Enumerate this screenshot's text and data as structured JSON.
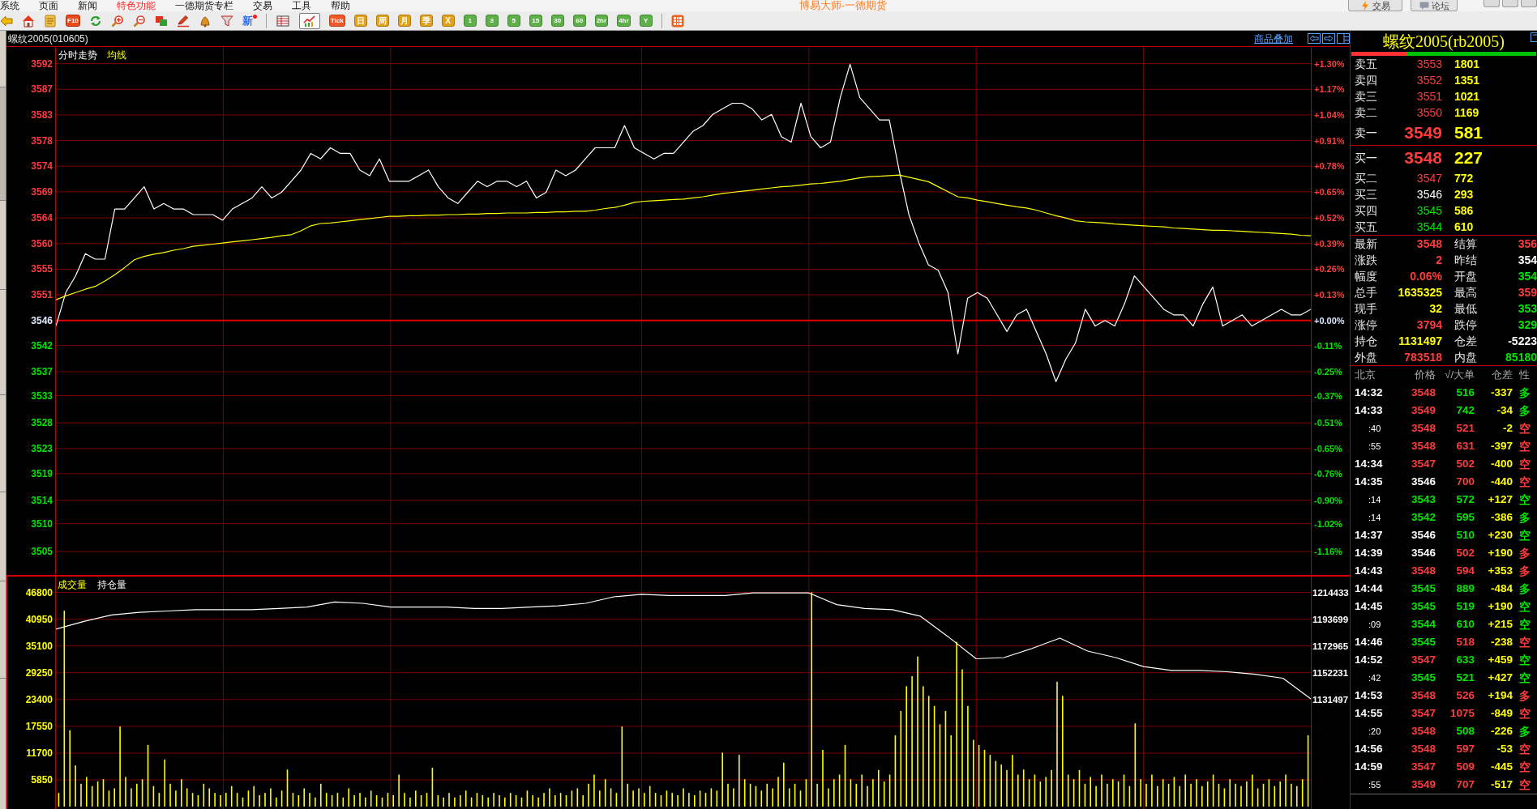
{
  "menu": [
    {
      "label": "系统",
      "highlight": false
    },
    {
      "label": "页面",
      "highlight": false
    },
    {
      "label": "新闻",
      "highlight": false
    },
    {
      "label": "特色功能",
      "highlight": true
    },
    {
      "label": "一德期货专栏",
      "highlight": false
    },
    {
      "label": "交易",
      "highlight": false
    },
    {
      "label": "工具",
      "highlight": false
    },
    {
      "label": "帮助",
      "highlight": false
    }
  ],
  "window": {
    "title": "博易大师-一德期货"
  },
  "top_buttons": [
    {
      "kind": "trade",
      "label": "交易"
    },
    {
      "kind": "forum",
      "label": "论坛"
    }
  ],
  "toolbar": {
    "f10_label": "F10",
    "new_label": "新",
    "views": [
      {
        "selected": false
      },
      {
        "selected": true
      }
    ],
    "periods": [
      {
        "kind": "tick",
        "label": "Tick",
        "selected": false
      },
      {
        "kind": "calendar",
        "label": "日",
        "selected": false
      },
      {
        "kind": "calendar",
        "label": "周",
        "selected": false
      },
      {
        "kind": "calendar",
        "label": "月",
        "selected": false
      },
      {
        "kind": "calendar",
        "label": "季",
        "selected": false
      },
      {
        "kind": "calendar",
        "label": "X",
        "selected": false
      },
      {
        "kind": "interval",
        "label": "1",
        "selected": false
      },
      {
        "kind": "interval",
        "label": "3",
        "selected": false
      },
      {
        "kind": "interval",
        "label": "5",
        "selected": false
      },
      {
        "kind": "interval",
        "label": "15",
        "selected": false
      },
      {
        "kind": "interval",
        "label": "30",
        "selected": false
      },
      {
        "kind": "interval",
        "label": "60",
        "selected": false
      },
      {
        "kind": "interval",
        "label": "2hr",
        "selected": false
      },
      {
        "kind": "interval",
        "label": "4hr",
        "selected": false
      },
      {
        "kind": "interval",
        "label": "Y",
        "selected": false
      }
    ]
  },
  "chart_header": {
    "symbol": "螺纹2005(010605)",
    "overlay_link": "商品叠加"
  },
  "price_chart": {
    "percent_labels": [
      "+1.30%",
      "+1.17%",
      "+1.04%",
      "+0.91%",
      "+0.78%",
      "+0.65%",
      "+0.52%",
      "+0.39%",
      "+0.26%",
      "+0.13%",
      "+0.00%",
      "-0.11%",
      "-0.25%",
      "-0.37%",
      "-0.51%",
      "-0.65%",
      "-0.76%",
      "-0.90%",
      "-1.02%",
      "-1.16%"
    ],
    "chart_data": {
      "type": "line",
      "ylim": [
        3500.3,
        3595.1
      ],
      "yticks": [
        {
          "value": 3592.1,
          "label": "3592"
        },
        {
          "value": 3587.5,
          "label": "3587"
        },
        {
          "value": 3582.9,
          "label": "3583"
        },
        {
          "value": 3578.3,
          "label": "3578"
        },
        {
          "value": 3573.7,
          "label": "3574"
        },
        {
          "value": 3569.1,
          "label": "3569"
        },
        {
          "value": 3564.4,
          "label": "3564"
        },
        {
          "value": 3559.8,
          "label": "3560"
        },
        {
          "value": 3555.2,
          "label": "3555"
        },
        {
          "value": 3550.6,
          "label": "3551"
        },
        {
          "value": 3546,
          "label": "3546"
        },
        {
          "value": 3541.5,
          "label": "3542"
        },
        {
          "value": 3536.8,
          "label": "3537"
        },
        {
          "value": 3532.5,
          "label": "3533"
        },
        {
          "value": 3527.6,
          "label": "3528"
        },
        {
          "value": 3523.0,
          "label": "3523"
        },
        {
          "value": 3518.5,
          "label": "3519"
        },
        {
          "value": 3513.7,
          "label": "3514"
        },
        {
          "value": 3509.5,
          "label": "3510"
        },
        {
          "value": 3504.5,
          "label": "3505"
        }
      ],
      "grid": true,
      "series": [
        {
          "name": "分时走势",
          "color": "#ffffff",
          "values": [
            3545,
            3551,
            3554,
            3558,
            3557,
            3557,
            3566,
            3566,
            3568,
            3570,
            3566,
            3567,
            3566,
            3566,
            3565,
            3565,
            3565,
            3564,
            3566,
            3567,
            3568,
            3570,
            3568,
            3569,
            3571,
            3573,
            3576,
            3575,
            3577,
            3576,
            3576,
            3573,
            3572,
            3575,
            3571,
            3571,
            3571,
            3572,
            3573,
            3570,
            3568,
            3567,
            3569,
            3571,
            3570,
            3571,
            3571,
            3570,
            3571,
            3568,
            3569,
            3573,
            3572,
            3573,
            3575,
            3577,
            3577,
            3577,
            3581,
            3577,
            3576,
            3575,
            3576,
            3576,
            3578,
            3580,
            3581,
            3583,
            3584,
            3585,
            3585,
            3584,
            3582,
            3583,
            3579,
            3578,
            3585,
            3579,
            3577,
            3578,
            3586,
            3592,
            3586,
            3584,
            3582,
            3582,
            3573,
            3565,
            3560,
            3556,
            3555,
            3551,
            3540,
            3550,
            3551,
            3550,
            3547,
            3544,
            3547,
            3548,
            3544,
            3540,
            3535,
            3539,
            3542,
            3548,
            3545,
            3546,
            3545,
            3549,
            3554,
            3552,
            3550,
            3548,
            3547,
            3547,
            3545,
            3549,
            3552,
            3545,
            3546,
            3547,
            3545,
            3546,
            3547,
            3548,
            3547,
            3547,
            3548
          ]
        },
        {
          "name": "均线",
          "color": "#ffff00",
          "values": [
            3549.7,
            3550.4,
            3551.0,
            3551.6,
            3552.1,
            3553.1,
            3554.2,
            3555.5,
            3556.9,
            3557.5,
            3557.9,
            3558.2,
            3558.6,
            3558.9,
            3559.3,
            3559.5,
            3559.7,
            3559.9,
            3560.1,
            3560.3,
            3560.5,
            3560.7,
            3560.9,
            3561.2,
            3561.4,
            3562.1,
            3563.0,
            3563.4,
            3563.5,
            3563.7,
            3563.9,
            3564.1,
            3564.3,
            3564.5,
            3564.7,
            3564.7,
            3564.8,
            3564.8,
            3564.9,
            3564.9,
            3565.0,
            3565.0,
            3565.1,
            3565.1,
            3565.2,
            3565.2,
            3565.3,
            3565.3,
            3565.3,
            3565.4,
            3565.4,
            3565.5,
            3565.5,
            3565.6,
            3565.6,
            3565.8,
            3566.1,
            3566.3,
            3566.7,
            3567.2,
            3567.4,
            3567.5,
            3567.6,
            3567.7,
            3567.8,
            3568.0,
            3568.2,
            3568.5,
            3568.8,
            3569.0,
            3569.2,
            3569.4,
            3569.6,
            3569.8,
            3570.0,
            3570.1,
            3570.3,
            3570.5,
            3570.6,
            3570.8,
            3571.0,
            3571.3,
            3571.6,
            3571.8,
            3571.9,
            3572.0,
            3572.1,
            3571.7,
            3571.3,
            3570.9,
            3570.0,
            3569.1,
            3568.2,
            3568.0,
            3567.6,
            3567.3,
            3567.0,
            3566.7,
            3566.4,
            3566.2,
            3565.8,
            3565.3,
            3564.8,
            3564.4,
            3563.9,
            3563.7,
            3563.6,
            3563.5,
            3563.3,
            3563.2,
            3563.1,
            3563.0,
            3562.9,
            3562.8,
            3562.6,
            3562.5,
            3562.4,
            3562.3,
            3562.2,
            3562.2,
            3562.1,
            3562.0,
            3561.9,
            3561.8,
            3561.7,
            3561.6,
            3561.5,
            3561.3,
            3561.2
          ]
        }
      ],
      "ref_lines": [
        {
          "axis": "y",
          "value": 3546
        }
      ]
    }
  },
  "volume_chart": {
    "chart_data": {
      "type": "bar",
      "ylim": [
        -513,
        50250
      ],
      "yticks": [
        46800,
        40950,
        35100,
        29250,
        23400,
        17550,
        11700,
        5850
      ],
      "grid": true,
      "series": [
        {
          "name": "成交量",
          "color": "#ffff00",
          "values": [
            3000,
            42800,
            16700,
            9000,
            5000,
            6500,
            4500,
            5500,
            6000,
            3500,
            4000,
            17500,
            6500,
            4000,
            5000,
            6000,
            13500,
            4500,
            3000,
            10300,
            5000,
            3500,
            6000,
            4000,
            3000,
            2500,
            5000,
            4000,
            3000,
            2500,
            3000,
            4500,
            3000,
            2000,
            3500,
            4500,
            2500,
            3000,
            4000,
            2000,
            3500,
            8100,
            3000,
            2500,
            4000,
            3000,
            2000,
            5000,
            3000,
            2500,
            3000,
            2000,
            4000,
            2500,
            3000,
            2000,
            3500,
            2500,
            2000,
            3000,
            2500,
            7000,
            3000,
            2000,
            3500,
            2500,
            3000,
            8500,
            2500,
            2000,
            3000,
            2000,
            2500,
            3500,
            2000,
            3000,
            2500,
            2000,
            3000,
            2500,
            2000,
            3000,
            2500,
            2000,
            3500,
            2500,
            2000,
            3000,
            4000,
            2500,
            3000,
            2500,
            3500,
            4000,
            2500,
            5000,
            7000,
            3500,
            6000,
            4000,
            3000,
            17500,
            5000,
            3500,
            4000,
            3000,
            4500,
            3000,
            2500,
            3500,
            3000,
            2500,
            4000,
            3000,
            2500,
            3500,
            3000,
            4000,
            3500,
            11800,
            5000,
            4000,
            11300,
            6000,
            5000,
            4500,
            3500,
            5000,
            4000,
            6500,
            9600,
            4000,
            5000,
            3500,
            6000,
            46800,
            5000,
            12400,
            4000,
            6000,
            7000,
            13500,
            6000,
            5000,
            7000,
            4500,
            6000,
            8000,
            5500,
            7000,
            15600,
            20900,
            26300,
            28500,
            32800,
            26300,
            24200,
            22000,
            18000,
            20900,
            15600,
            36000,
            30000,
            22000,
            14600,
            13500,
            12400,
            11300,
            10000,
            9200,
            8000,
            11300,
            7000,
            8100,
            6000,
            7000,
            5500,
            6500,
            8000,
            27300,
            24200,
            7000,
            6000,
            8000,
            5000,
            6500,
            4500,
            7000,
            5000,
            6000,
            5500,
            7000,
            4500,
            18200,
            6000,
            5000,
            7000,
            4500,
            6000,
            5000,
            6500,
            4500,
            7000,
            5000,
            6000,
            4500,
            5500,
            7000,
            5000,
            4000,
            6000,
            5000,
            4500,
            5500,
            7000,
            4000,
            5000,
            6000,
            4500,
            5500,
            7000,
            5000,
            4500,
            6000,
            15600
          ]
        }
      ]
    }
  },
  "open_interest_chart": {
    "chart_data": {
      "type": "line",
      "ylim": [
        1131497,
        1214433
      ],
      "yticks": [
        1214433,
        1193699,
        1172965,
        1152231,
        1131497
      ],
      "series": [
        {
          "name": "持仓量",
          "color": "#ffffff",
          "values": [
            1186000,
            1192000,
            1197000,
            1199000,
            1200000,
            1201000,
            1201000,
            1201000,
            1202000,
            1203000,
            1207000,
            1206000,
            1203000,
            1203000,
            1203000,
            1202000,
            1202000,
            1203000,
            1204000,
            1206000,
            1211000,
            1213000,
            1212000,
            1212000,
            1212000,
            1214000,
            1214000,
            1214000,
            1205000,
            1202000,
            1201000,
            1196000,
            1180000,
            1163000,
            1164000,
            1171000,
            1179000,
            1169000,
            1164000,
            1157000,
            1154000,
            1154000,
            1153000,
            1151000,
            1148000,
            1132000
          ]
        }
      ]
    }
  },
  "quote": {
    "title": "螺纹2005(rb2005)",
    "ratio_bar": {
      "level": 0.3
    },
    "asks": [
      {
        "kind": "level",
        "label": "卖五",
        "price": "3553",
        "color": "#ff3c3c",
        "volume": "1801"
      },
      {
        "kind": "level",
        "label": "卖四",
        "price": "3552",
        "color": "#ff3c3c",
        "volume": "1351"
      },
      {
        "kind": "level",
        "label": "卖三",
        "price": "3551",
        "color": "#ff3c3c",
        "volume": "1021"
      },
      {
        "kind": "level",
        "label": "卖二",
        "price": "3550",
        "color": "#ff3c3c",
        "volume": "1169"
      },
      {
        "kind": "best",
        "label": "卖一",
        "price": "3549",
        "color": "#ff3c3c",
        "volume": "581"
      }
    ],
    "bids": [
      {
        "kind": "best",
        "label": "买一",
        "price": "3548",
        "color": "#ff3c3c",
        "volume": "227"
      },
      {
        "kind": "level",
        "label": "买二",
        "price": "3547",
        "color": "#ff3c3c",
        "volume": "772"
      },
      {
        "kind": "level",
        "label": "买三",
        "price": "3546",
        "color": "#ffffff",
        "volume": "293"
      },
      {
        "kind": "level",
        "label": "买四",
        "price": "3545",
        "color": "#00e600",
        "volume": "586"
      },
      {
        "kind": "level",
        "label": "买五",
        "price": "3544",
        "color": "#00e600",
        "volume": "610"
      }
    ],
    "stats": [
      {
        "cells": [
          {
            "label": "最新",
            "value": "3548",
            "color": "#ff3c3c"
          },
          {
            "label": "结算",
            "value": "356",
            "color": "#ff3c3c"
          }
        ]
      },
      {
        "cells": [
          {
            "label": "涨跌",
            "value": "2",
            "color": "#ff3c3c"
          },
          {
            "label": "昨结",
            "value": "354",
            "color": "#ffffff"
          }
        ]
      },
      {
        "cells": [
          {
            "label": "幅度",
            "value": "0.06%",
            "color": "#ff3c3c"
          },
          {
            "label": "开盘",
            "value": "354",
            "color": "#00e600"
          }
        ]
      },
      {
        "cells": [
          {
            "label": "总手",
            "value": "1635325",
            "color": "#ffff00"
          },
          {
            "label": "最高",
            "value": "359",
            "color": "#ff3c3c"
          }
        ]
      },
      {
        "cells": [
          {
            "label": "现手",
            "value": "32",
            "color": "#ffff00"
          },
          {
            "label": "最低",
            "value": "353",
            "color": "#00e600"
          }
        ]
      },
      {
        "cells": [
          {
            "label": "涨停",
            "value": "3794",
            "color": "#ff3c3c"
          },
          {
            "label": "跌停",
            "value": "329",
            "color": "#00e600"
          }
        ]
      },
      {
        "cells": [
          {
            "label": "持仓",
            "value": "1131497",
            "color": "#ffff00"
          },
          {
            "label": "仓差",
            "value": "-5223",
            "color": "#ffffff"
          }
        ]
      },
      {
        "cells": [
          {
            "label": "外盘",
            "value": "783518",
            "color": "#ff3c3c"
          },
          {
            "label": "内盘",
            "value": "85180",
            "color": "#00e600"
          }
        ]
      }
    ]
  },
  "trades": {
    "columns": [
      "北京",
      "价格",
      "√/大单",
      "仓差",
      "性"
    ],
    "rows": [
      {
        "kind": "minute",
        "time": "14:32",
        "price": {
          "text": "3548",
          "color": "#ff3c3c"
        },
        "volume": {
          "text": "516",
          "color": "#00e600"
        },
        "oi_change": "-337",
        "type": {
          "text": "多",
          "color": "#00e600"
        }
      },
      {
        "kind": "minute",
        "time": "14:33",
        "price": {
          "text": "3549",
          "color": "#ff3c3c"
        },
        "volume": {
          "text": "742",
          "color": "#00e600"
        },
        "oi_change": "-34",
        "type": {
          "text": "多",
          "color": "#00e600"
        }
      },
      {
        "kind": "seconds",
        "time": ":40",
        "price": {
          "text": "3548",
          "color": "#ff3c3c"
        },
        "volume": {
          "text": "521",
          "color": "#ff3c3c"
        },
        "oi_change": "-2",
        "type": {
          "text": "空",
          "color": "#ff3c3c"
        }
      },
      {
        "kind": "seconds",
        "time": ":55",
        "price": {
          "text": "3548",
          "color": "#ff3c3c"
        },
        "volume": {
          "text": "631",
          "color": "#ff3c3c"
        },
        "oi_change": "-397",
        "type": {
          "text": "空",
          "color": "#ff3c3c"
        }
      },
      {
        "kind": "minute",
        "time": "14:34",
        "price": {
          "text": "3547",
          "color": "#ff3c3c"
        },
        "volume": {
          "text": "502",
          "color": "#ff3c3c"
        },
        "oi_change": "-400",
        "type": {
          "text": "空",
          "color": "#ff3c3c"
        }
      },
      {
        "kind": "minute",
        "time": "14:35",
        "price": {
          "text": "3546",
          "color": "#ffffff"
        },
        "volume": {
          "text": "700",
          "color": "#ff3c3c"
        },
        "oi_change": "-440",
        "type": {
          "text": "空",
          "color": "#ff3c3c"
        }
      },
      {
        "kind": "seconds",
        "time": ":14",
        "price": {
          "text": "3543",
          "color": "#00e600"
        },
        "volume": {
          "text": "572",
          "color": "#00e600"
        },
        "oi_change": "+127",
        "type": {
          "text": "空",
          "color": "#00e600"
        }
      },
      {
        "kind": "seconds",
        "time": ":14",
        "price": {
          "text": "3542",
          "color": "#00e600"
        },
        "volume": {
          "text": "595",
          "color": "#00e600"
        },
        "oi_change": "-386",
        "type": {
          "text": "多",
          "color": "#00e600"
        }
      },
      {
        "kind": "minute",
        "time": "14:37",
        "price": {
          "text": "3546",
          "color": "#ffffff"
        },
        "volume": {
          "text": "510",
          "color": "#00e600"
        },
        "oi_change": "+230",
        "type": {
          "text": "空",
          "color": "#00e600"
        }
      },
      {
        "kind": "minute",
        "time": "14:39",
        "price": {
          "text": "3546",
          "color": "#ffffff"
        },
        "volume": {
          "text": "502",
          "color": "#ff3c3c"
        },
        "oi_change": "+190",
        "type": {
          "text": "多",
          "color": "#ff3c3c"
        }
      },
      {
        "kind": "minute",
        "time": "14:43",
        "price": {
          "text": "3548",
          "color": "#ff3c3c"
        },
        "volume": {
          "text": "594",
          "color": "#ff3c3c"
        },
        "oi_change": "+353",
        "type": {
          "text": "多",
          "color": "#ff3c3c"
        }
      },
      {
        "kind": "minute",
        "time": "14:44",
        "price": {
          "text": "3545",
          "color": "#00e600"
        },
        "volume": {
          "text": "889",
          "color": "#00e600"
        },
        "oi_change": "-484",
        "type": {
          "text": "多",
          "color": "#00e600"
        }
      },
      {
        "kind": "minute",
        "time": "14:45",
        "price": {
          "text": "3545",
          "color": "#00e600"
        },
        "volume": {
          "text": "519",
          "color": "#00e600"
        },
        "oi_change": "+190",
        "type": {
          "text": "空",
          "color": "#00e600"
        }
      },
      {
        "kind": "seconds",
        "time": ":09",
        "price": {
          "text": "3544",
          "color": "#00e600"
        },
        "volume": {
          "text": "610",
          "color": "#00e600"
        },
        "oi_change": "+215",
        "type": {
          "text": "空",
          "color": "#00e600"
        }
      },
      {
        "kind": "minute",
        "time": "14:46",
        "price": {
          "text": "3545",
          "color": "#00e600"
        },
        "volume": {
          "text": "518",
          "color": "#ff3c3c"
        },
        "oi_change": "-238",
        "type": {
          "text": "空",
          "color": "#ff3c3c"
        }
      },
      {
        "kind": "minute",
        "time": "14:52",
        "price": {
          "text": "3547",
          "color": "#ff3c3c"
        },
        "volume": {
          "text": "633",
          "color": "#00e600"
        },
        "oi_change": "+459",
        "type": {
          "text": "空",
          "color": "#00e600"
        }
      },
      {
        "kind": "seconds",
        "time": ":42",
        "price": {
          "text": "3545",
          "color": "#00e600"
        },
        "volume": {
          "text": "521",
          "color": "#00e600"
        },
        "oi_change": "+427",
        "type": {
          "text": "空",
          "color": "#00e600"
        }
      },
      {
        "kind": "minute",
        "time": "14:53",
        "price": {
          "text": "3548",
          "color": "#ff3c3c"
        },
        "volume": {
          "text": "526",
          "color": "#ff3c3c"
        },
        "oi_change": "+194",
        "type": {
          "text": "多",
          "color": "#ff3c3c"
        }
      },
      {
        "kind": "minute",
        "time": "14:55",
        "price": {
          "text": "3547",
          "color": "#ff3c3c"
        },
        "volume": {
          "text": "1075",
          "color": "#ff3c3c"
        },
        "oi_change": "-849",
        "type": {
          "text": "空",
          "color": "#ff3c3c"
        }
      },
      {
        "kind": "seconds",
        "time": ":20",
        "price": {
          "text": "3548",
          "color": "#ff3c3c"
        },
        "volume": {
          "text": "508",
          "color": "#00e600"
        },
        "oi_change": "-226",
        "type": {
          "text": "多",
          "color": "#00e600"
        }
      },
      {
        "kind": "minute",
        "time": "14:56",
        "price": {
          "text": "3548",
          "color": "#ff3c3c"
        },
        "volume": {
          "text": "597",
          "color": "#ff3c3c"
        },
        "oi_change": "-53",
        "type": {
          "text": "空",
          "color": "#ff3c3c"
        }
      },
      {
        "kind": "minute",
        "time": "14:59",
        "price": {
          "text": "3547",
          "color": "#ff3c3c"
        },
        "volume": {
          "text": "509",
          "color": "#ff3c3c"
        },
        "oi_change": "-445",
        "type": {
          "text": "空",
          "color": "#ff3c3c"
        }
      },
      {
        "kind": "seconds",
        "time": ":55",
        "price": {
          "text": "3549",
          "color": "#ff3c3c"
        },
        "volume": {
          "text": "707",
          "color": "#ff3c3c"
        },
        "oi_change": "-517",
        "type": {
          "text": "空",
          "color": "#ff3c3c"
        }
      }
    ]
  }
}
